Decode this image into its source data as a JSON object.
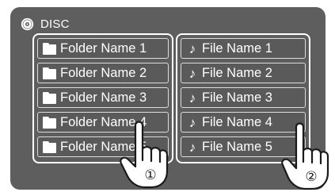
{
  "header": {
    "title": "DISC",
    "icon": "disc-icon"
  },
  "folders": [
    {
      "label": "Folder Name 1",
      "icon": "folder-icon"
    },
    {
      "label": "Folder Name 2",
      "icon": "folder-icon"
    },
    {
      "label": "Folder Name 3",
      "icon": "folder-icon"
    },
    {
      "label": "Folder Name 4",
      "icon": "folder-icon"
    },
    {
      "label": "Folder Name 5",
      "icon": "folder-icon"
    }
  ],
  "files": [
    {
      "label": "File Name 1",
      "icon": "music-note-icon"
    },
    {
      "label": "File Name 2",
      "icon": "music-note-icon"
    },
    {
      "label": "File Name 3",
      "icon": "music-note-icon"
    },
    {
      "label": "File Name 4",
      "icon": "music-note-icon"
    },
    {
      "label": "File Name 5",
      "icon": "music-note-icon"
    }
  ],
  "callouts": {
    "one": "①",
    "two": "②"
  },
  "colors": {
    "screen_bg": "#5e5e5e",
    "text": "#ffffff",
    "panel_border": "#ffffff"
  }
}
